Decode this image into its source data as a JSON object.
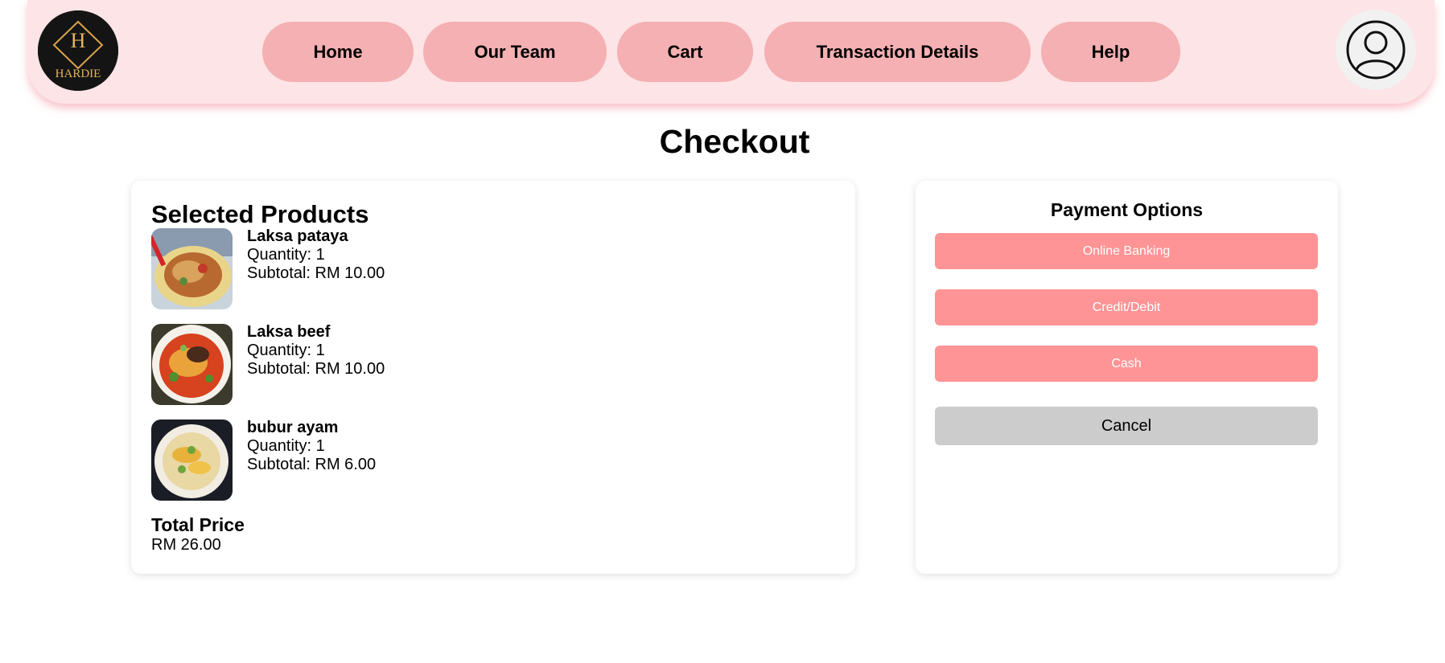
{
  "brand": {
    "logo_text": "HARDIE",
    "logo_letter": "H"
  },
  "nav": {
    "items": [
      {
        "label": "Home"
      },
      {
        "label": "Our Team"
      },
      {
        "label": "Cart"
      },
      {
        "label": "Transaction Details"
      },
      {
        "label": "Help"
      }
    ],
    "profile_icon": "user-circle-icon"
  },
  "page": {
    "title": "Checkout"
  },
  "products": {
    "heading": "Selected Products",
    "items": [
      {
        "name": "Laksa pataya",
        "quantity": "Quantity: 1",
        "subtotal": "Subtotal: RM 10.00"
      },
      {
        "name": "Laksa beef",
        "quantity": "Quantity: 1",
        "subtotal": "Subtotal: RM 10.00"
      },
      {
        "name": "bubur ayam",
        "quantity": "Quantity: 1",
        "subtotal": "Subtotal: RM 6.00"
      }
    ],
    "total_label": "Total Price",
    "total_value": "RM 26.00"
  },
  "payment": {
    "heading": "Payment Options",
    "options": [
      "Online Banking",
      "Credit/Debit",
      "Cash"
    ],
    "cancel_label": "Cancel"
  },
  "colors": {
    "navbar_bg": "#fde4e6",
    "nav_button": "#f4b0b2",
    "payment_button": "#fe9496",
    "cancel_button": "#cccccc"
  }
}
